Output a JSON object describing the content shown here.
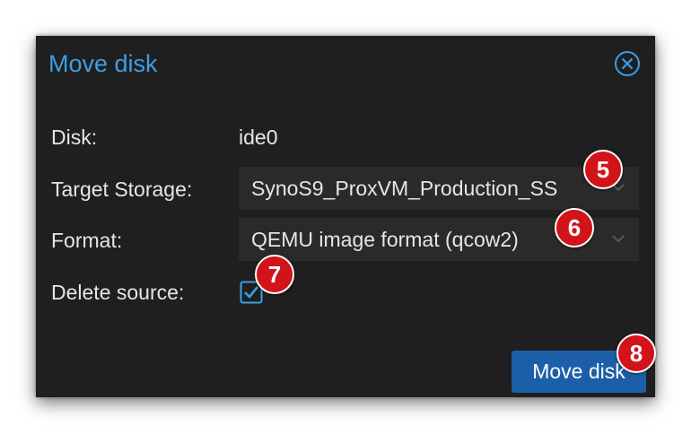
{
  "dialog": {
    "title": "Move disk",
    "close_icon": "close-circle-icon"
  },
  "form": {
    "disk_label": "Disk:",
    "disk_value": "ide0",
    "target_storage_label": "Target Storage:",
    "target_storage_value": "SynoS9_ProxVM_Production_SS",
    "format_label": "Format:",
    "format_value": "QEMU image format (qcow2)",
    "delete_source_label": "Delete source:",
    "delete_source_checked": true
  },
  "actions": {
    "move_disk_label": "Move disk"
  },
  "badges": [
    "5",
    "6",
    "7",
    "8"
  ],
  "colors": {
    "accent": "#3c9ee5",
    "dialog_bg": "#1f1f1f",
    "field_bg": "#2a2a2a",
    "button_bg": "#1c5fa8",
    "badge_bg": "#d01419"
  }
}
